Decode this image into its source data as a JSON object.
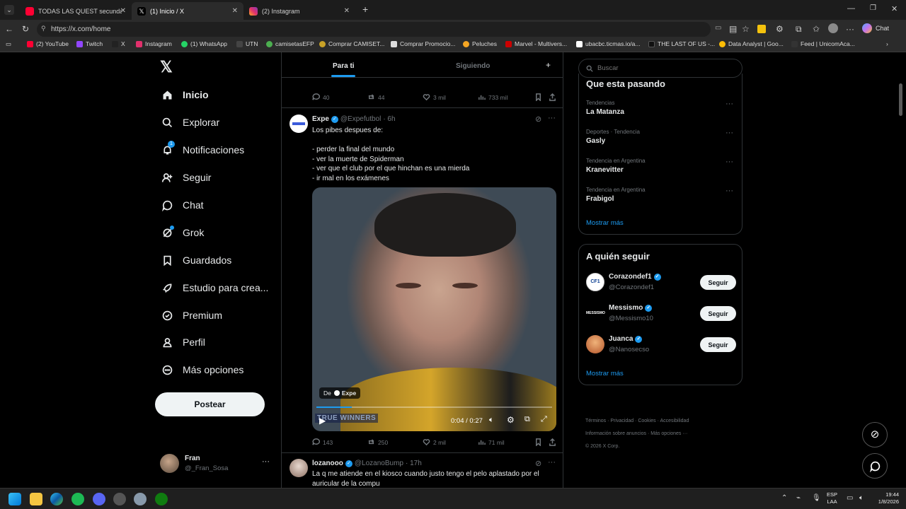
{
  "browser": {
    "tabs": [
      {
        "label": "TODAS LAS QUEST secundarias de",
        "active": false
      },
      {
        "label": "(1) Inicio / X",
        "active": true
      },
      {
        "label": "(2) Instagram",
        "active": false
      }
    ],
    "address": "https://x.com/home",
    "bookmarks": [
      "(2) YouTube",
      "Twitch",
      "X",
      "Instagram",
      "(1) WhatsApp",
      "UTN",
      "camisetasEFP",
      "Comprar CAMISET...",
      "Comprar Promocio...",
      "Peluches",
      "Marvel - Multivers...",
      "ubacbc.ticmas.io/a...",
      "THE LAST OF US -...",
      "Data Analyst | Goo...",
      "Feed | UnicomAca..."
    ],
    "chat_label": "Chat"
  },
  "sidebar": {
    "items": [
      {
        "label": "Inicio",
        "icon": "home-icon"
      },
      {
        "label": "Explorar",
        "icon": "search-icon"
      },
      {
        "label": "Notificaciones",
        "icon": "bell-icon",
        "badge": "1"
      },
      {
        "label": "Seguir",
        "icon": "person-add-icon"
      },
      {
        "label": "Chat",
        "icon": "chat-icon"
      },
      {
        "label": "Grok",
        "icon": "grok-icon"
      },
      {
        "label": "Guardados",
        "icon": "bookmark-icon"
      },
      {
        "label": "Estudio para crea...",
        "icon": "rocket-icon"
      },
      {
        "label": "Premium",
        "icon": "verified-icon"
      },
      {
        "label": "Perfil",
        "icon": "person-icon"
      },
      {
        "label": "Más opciones",
        "icon": "more-circle-icon"
      }
    ],
    "post_label": "Postear",
    "account": {
      "name": "Fran",
      "handle": "@_Fran_Sosa"
    }
  },
  "feed": {
    "tabs": [
      "Para ti",
      "Siguiendo"
    ],
    "prev_metrics": {
      "replies": "40",
      "reposts": "44",
      "likes": "3 mil",
      "views": "733 mil"
    },
    "tweet1": {
      "name": "Expe",
      "handle": "@Expefutbol",
      "time": "· 6h",
      "lines": [
        "Los pibes despues de:",
        "",
        "- perder la final del mundo",
        "- ver la muerte de Spiderman",
        "- ver que el club por el que hinchan es una mierda",
        "- ir mal en los exámenes"
      ],
      "video_source": "De",
      "video_source_name": "Expe",
      "video_overlay": "TRUE WINNERS",
      "video_time": "0:04 / 0:27",
      "video_progress": 0.15,
      "metrics": {
        "replies": "143",
        "reposts": "250",
        "likes": "2 mil",
        "views": "71 mil"
      }
    },
    "tweet2": {
      "name": "lozanooo",
      "handle": "@LozanoBump",
      "time": "· 17h",
      "text": "La q me atiende en el kiosco cuando justo tengo el pelo aplastado por el auricular de la compu"
    }
  },
  "right": {
    "search_placeholder": "Buscar",
    "trends_title": "Que esta pasando",
    "trends": [
      {
        "category": "Tendencias",
        "name": "La Matanza"
      },
      {
        "category": "Deportes · Tendencia",
        "name": "Gasly"
      },
      {
        "category": "Tendencia en Argentina",
        "name": "Kranevitter"
      },
      {
        "category": "Tendencia en Argentina",
        "name": "Frabigol"
      }
    ],
    "show_more": "Mostrar más",
    "follow_title": "A quién seguir",
    "follow": [
      {
        "name": "Corazondef1",
        "handle": "@Corazondef1",
        "button": "Seguir"
      },
      {
        "name": "Messismo",
        "handle": "@Messismo10",
        "button": "Seguir"
      },
      {
        "name": "Juanca",
        "handle": "@Nanosecso",
        "button": "Seguir"
      }
    ],
    "follow_more": "Mostrar más",
    "footer_links": [
      "Términos",
      "Privacidad",
      "Cookies",
      "Accesibilidad",
      "Información sobre anuncios",
      "Más opciones ···"
    ],
    "copyright": "© 2026 X Corp."
  },
  "taskbar": {
    "lang1": "ESP",
    "lang2": "LAA",
    "time": "19:44",
    "date": "1/8/2026"
  },
  "colors": {
    "accent": "#1d9bf0",
    "verified": "#1d9bf0",
    "bg": "#000000",
    "border": "#2f3336"
  }
}
